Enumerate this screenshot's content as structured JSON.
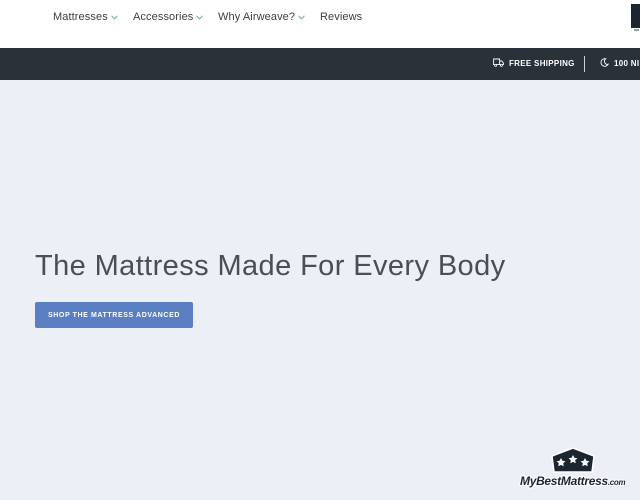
{
  "nav": {
    "items": [
      {
        "label": "Mattresses",
        "has_dropdown": true
      },
      {
        "label": "Accessories",
        "has_dropdown": true
      },
      {
        "label": "Why Airweave?",
        "has_dropdown": true
      },
      {
        "label": "Reviews",
        "has_dropdown": false
      }
    ],
    "chevron_color": "#5aa9a1"
  },
  "promo_bar": {
    "shipping_label": "FREE SHIPPING",
    "nights_label": "100 NI",
    "shipping_icon": "truck-icon",
    "nights_icon": "moon-icon"
  },
  "hero": {
    "title": "The Mattress Made For Every Body",
    "cta_label": "SHOP THE MATTRESS ADVANCED"
  },
  "watermark": {
    "brand_text": "MyBestMattress",
    "brand_suffix": ".com"
  },
  "colors": {
    "hero_background": "#eceff5",
    "promo_bar_background": "#2a3139",
    "cta_background": "#5a7fc2"
  }
}
